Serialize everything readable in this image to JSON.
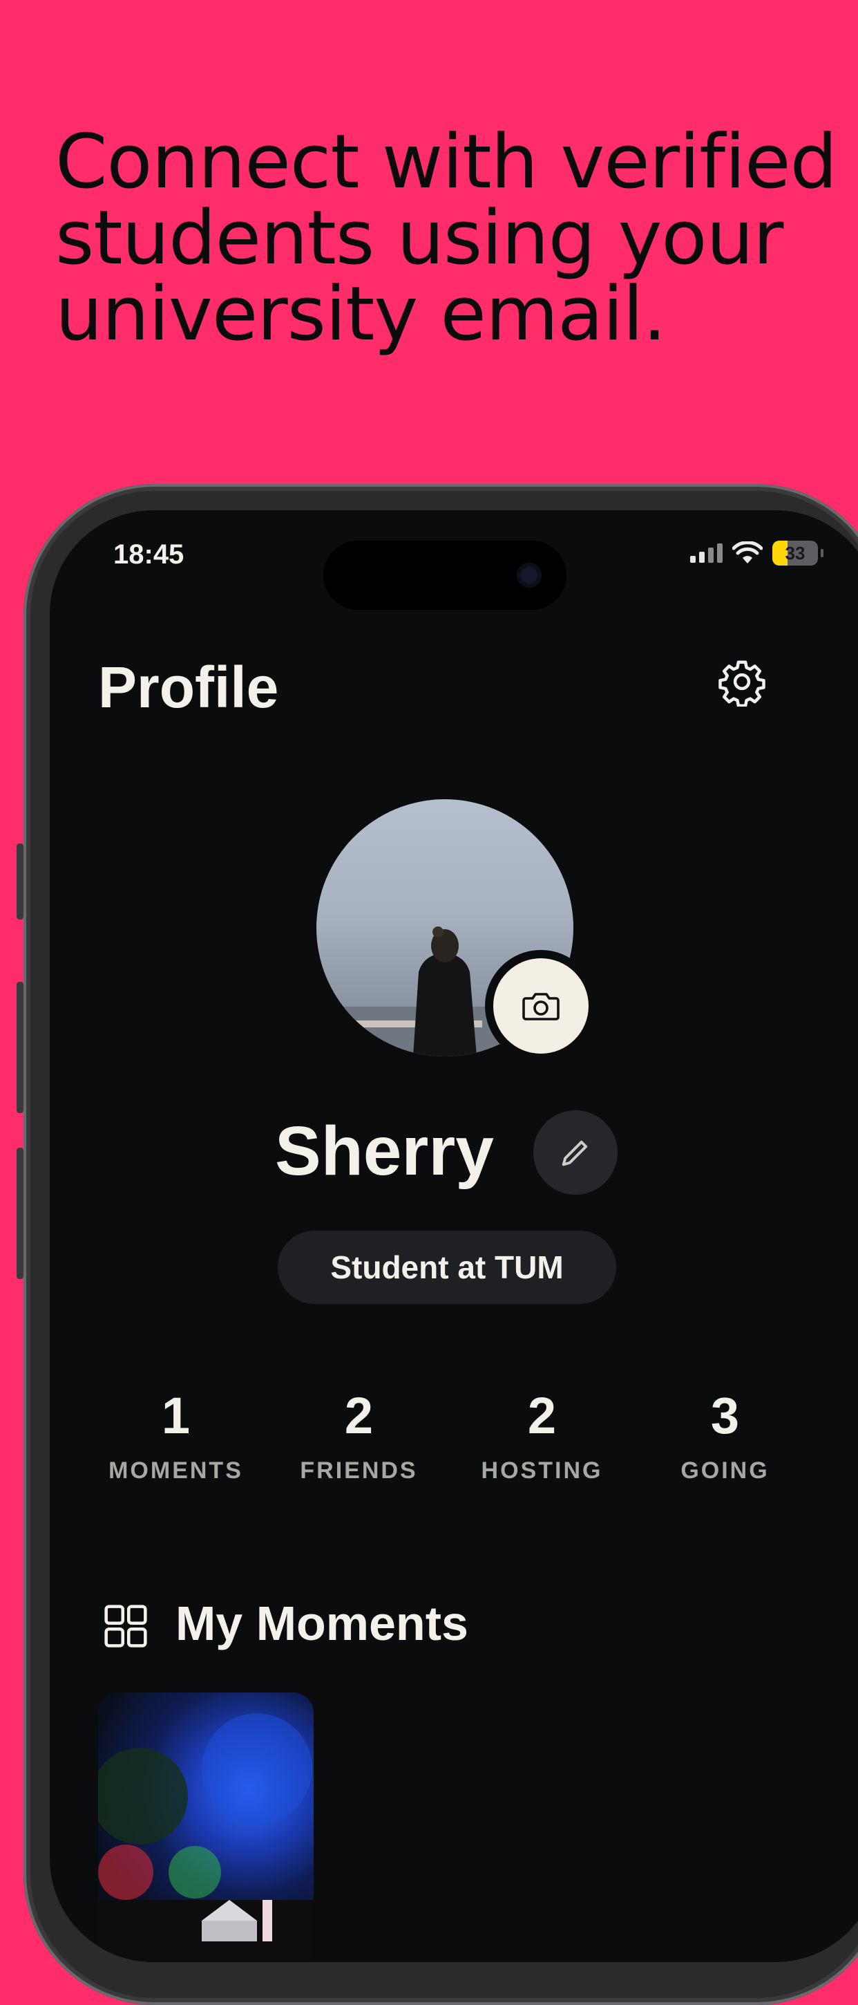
{
  "marketing": {
    "headline_lines": [
      "Connect with verified",
      "students using your",
      "university email."
    ]
  },
  "status_bar": {
    "time": "18:45",
    "battery_percent": "33",
    "icons": [
      "signal-icon",
      "wifi-icon",
      "battery-icon"
    ]
  },
  "header": {
    "title": "Profile",
    "settings_icon": "gear-icon"
  },
  "profile": {
    "name": "Sherry",
    "badge": "Student at TUM",
    "avatar_icon": "camera-icon",
    "edit_icon": "pencil-icon"
  },
  "stats": [
    {
      "value": "1",
      "label": "MOMENTS"
    },
    {
      "value": "2",
      "label": "FRIENDS"
    },
    {
      "value": "2",
      "label": "HOSTING"
    },
    {
      "value": "3",
      "label": "GOING"
    }
  ],
  "moments": {
    "title": "My Moments",
    "icon": "grid-icon"
  },
  "colors": {
    "background": "#ff2d6a",
    "screen": "#0b0c0d",
    "text": "#f3f1ea",
    "muted": "#a9a7a2",
    "battery_fill": "#ffd60a"
  }
}
